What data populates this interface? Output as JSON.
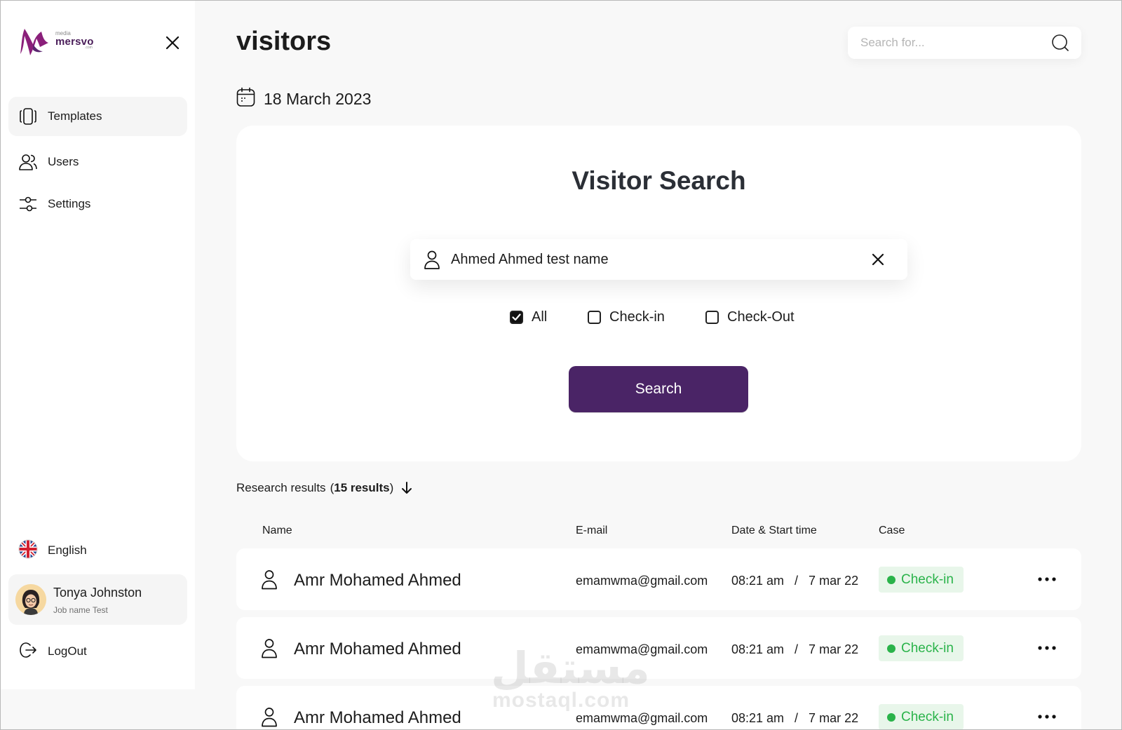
{
  "sidebar": {
    "logo": {
      "small_top": "media",
      "brand": "mersvo",
      "small_bottom": ".com"
    },
    "nav": [
      {
        "label": "Templates",
        "icon": "templates-icon",
        "active": true
      },
      {
        "label": "Users",
        "icon": "users-icon",
        "active": false
      },
      {
        "label": "Settings",
        "icon": "settings-sliders-icon",
        "active": false
      }
    ],
    "language": {
      "label": "English",
      "icon": "uk-flag-icon"
    },
    "profile": {
      "name": "Tonya Johnston",
      "job": "Job name Test"
    },
    "logout": {
      "label": "LogOut"
    }
  },
  "header": {
    "title": "visitors",
    "search_placeholder": "Search for..."
  },
  "date": {
    "label": "18 March 2023"
  },
  "visitor_search": {
    "title": "Visitor Search",
    "input_value": "Ahmed Ahmed test name",
    "filters": [
      {
        "label": "All",
        "checked": true
      },
      {
        "label": "Check-in",
        "checked": false
      },
      {
        "label": "Check-Out",
        "checked": false
      }
    ],
    "button_label": "Search"
  },
  "results": {
    "label": "Research results",
    "count_open": "(",
    "count_text": "15 results",
    "count_close": ")",
    "columns": [
      "Name",
      "E-mail",
      "Date & Start time",
      "Case"
    ],
    "rows": [
      {
        "name": "Amr Mohamed Ahmed",
        "email": "emamwma@gmail.com",
        "datetime": "08:21 am   /   7 mar 22",
        "case": "Check-in"
      },
      {
        "name": "Amr Mohamed Ahmed",
        "email": "emamwma@gmail.com",
        "datetime": "08:21 am   /   7 mar 22",
        "case": "Check-in"
      },
      {
        "name": "Amr Mohamed Ahmed",
        "email": "emamwma@gmail.com",
        "datetime": "08:21 am   /   7 mar 22",
        "case": "Check-in"
      }
    ]
  },
  "watermark": {
    "arabic": "مستقل",
    "latin": "mostaql.com"
  },
  "colors": {
    "accent": "#4a2466",
    "status_green": "#2ab34a",
    "status_green_bg": "#e8f6ea",
    "page_bg": "#f8f8f8"
  }
}
